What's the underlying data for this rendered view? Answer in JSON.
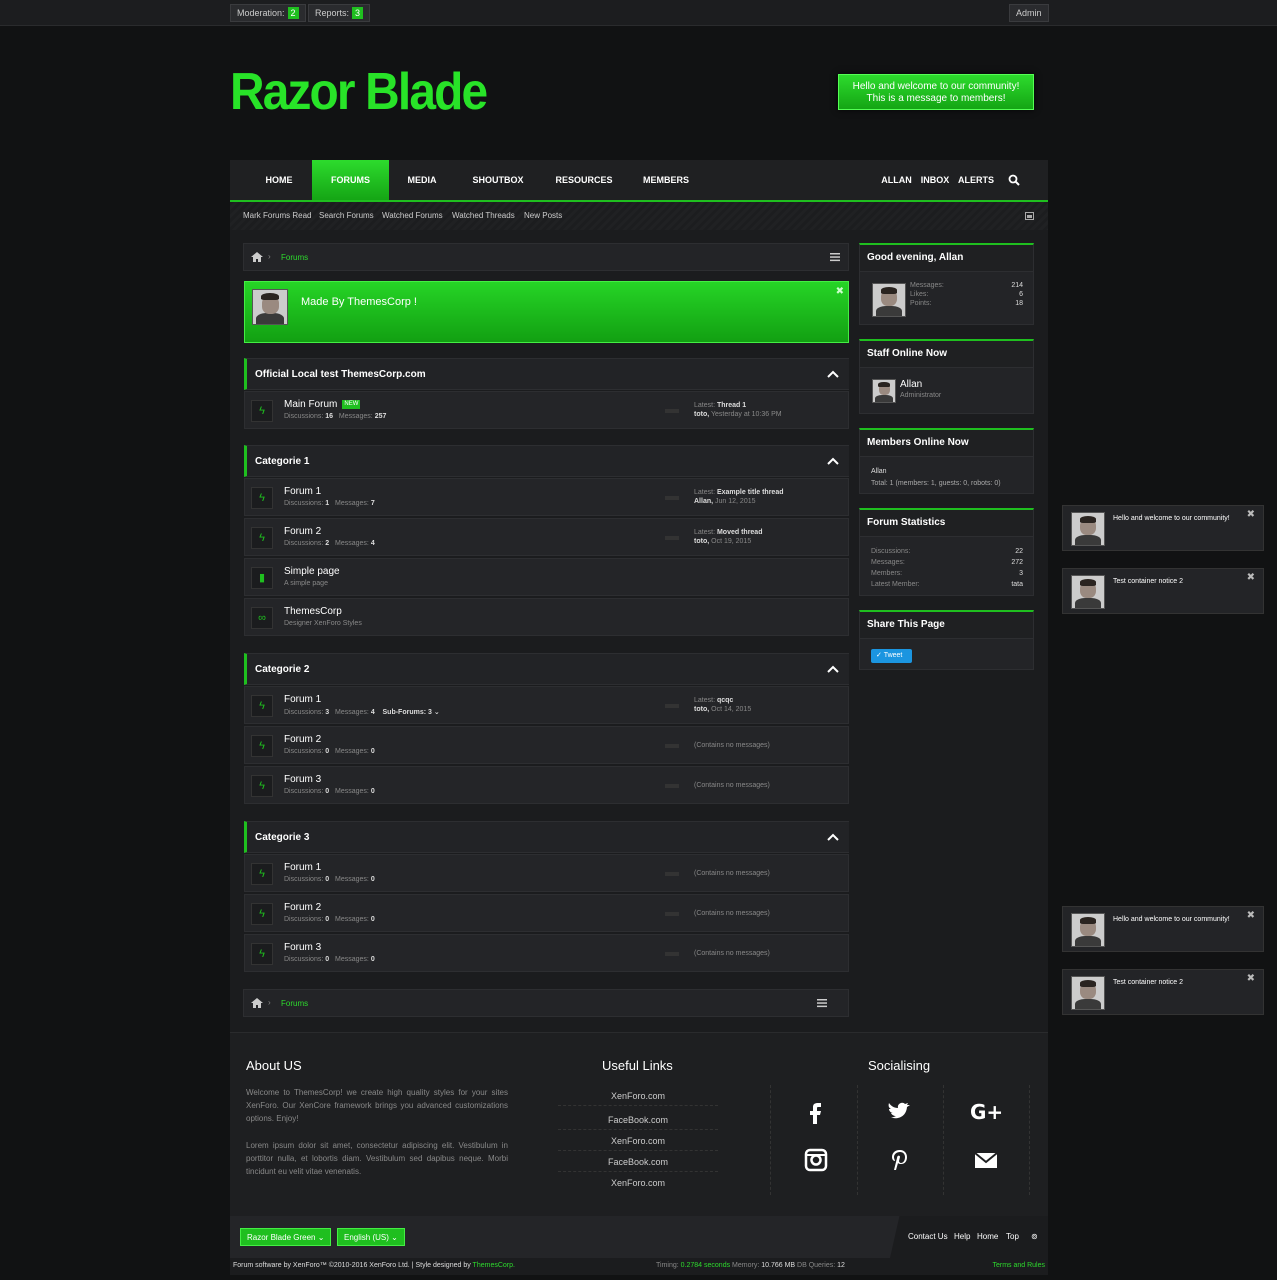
{
  "topbar": {
    "moderation_label": "Moderation:",
    "moderation_count": "2",
    "reports_label": "Reports:",
    "reports_count": "3",
    "admin_label": "Admin"
  },
  "logo": "Razor Blade",
  "welcome": {
    "line1": "Hello and welcome to our community!",
    "line2": "This is a message to members!"
  },
  "nav": {
    "items": [
      "HOME",
      "FORUMS",
      "MEDIA",
      "SHOUTBOX",
      "RESOURCES",
      "MEMBERS"
    ],
    "right": [
      "ALLAN",
      "INBOX",
      "ALERTS"
    ]
  },
  "subnav": [
    "Mark Forums Read",
    "Search Forums",
    "Watched Forums",
    "Watched Threads",
    "New Posts"
  ],
  "breadcrumb": "Forums",
  "notice": "Made By ThemesCorp !",
  "categories": [
    {
      "title": "Official Local test ThemesCorp.com"
    },
    {
      "title": "Categorie 1"
    },
    {
      "title": "Categorie 2"
    },
    {
      "title": "Categorie 3"
    }
  ],
  "rows": {
    "main": {
      "name": "Main Forum",
      "new": "NEW",
      "disc": "16",
      "msg": "257",
      "latest_label": "Latest:",
      "latest": "Thread 1",
      "by": "toto,",
      "when": "Yesterday at 10:36 PM"
    },
    "c1f1": {
      "name": "Forum 1",
      "disc": "1",
      "msg": "7",
      "latest": "Example title thread",
      "by": "Allan,",
      "when": "Jun 12, 2015"
    },
    "c1f2": {
      "name": "Forum 2",
      "disc": "2",
      "msg": "4",
      "latest": "Moved thread",
      "by": "toto,",
      "when": "Oct 19, 2015"
    },
    "simple": {
      "name": "Simple page",
      "desc": "A simple page"
    },
    "tc": {
      "name": "ThemesCorp",
      "desc": "Designer XenForo Styles"
    },
    "c2f1": {
      "name": "Forum 1",
      "disc": "3",
      "msg": "4",
      "sub": "Sub-Forums: 3",
      "latest": "qcqc",
      "by": "toto,",
      "when": "Oct 14, 2015"
    },
    "c2f2": {
      "name": "Forum 2",
      "disc": "0",
      "msg": "0"
    },
    "c2f3": {
      "name": "Forum 3",
      "disc": "0",
      "msg": "0"
    },
    "c3f1": {
      "name": "Forum 1",
      "disc": "0",
      "msg": "0"
    },
    "c3f2": {
      "name": "Forum 2",
      "disc": "0",
      "msg": "0"
    },
    "c3f3": {
      "name": "Forum 3",
      "disc": "0",
      "msg": "0"
    }
  },
  "labels": {
    "discussions": "Discussions:",
    "messages": "Messages:",
    "empty": "(Contains no messages)"
  },
  "sidebar": {
    "greeting": "Good evening, Allan",
    "user_stats": [
      {
        "k": "Messages:",
        "v": "214"
      },
      {
        "k": "Likes:",
        "v": "6"
      },
      {
        "k": "Points:",
        "v": "18"
      }
    ],
    "staff_title": "Staff Online Now",
    "staff_name": "Allan",
    "staff_role": "Administrator",
    "members_title": "Members Online Now",
    "members_name": "Allan",
    "members_total": "Total: 1 (members: 1, guests: 0, robots: 0)",
    "stats_title": "Forum Statistics",
    "stats": [
      {
        "k": "Discussions:",
        "v": "22"
      },
      {
        "k": "Messages:",
        "v": "272"
      },
      {
        "k": "Members:",
        "v": "3"
      },
      {
        "k": "Latest Member:",
        "v": "tata"
      }
    ],
    "share_title": "Share This Page",
    "tweet": "Tweet"
  },
  "footer": {
    "about_title": "About US",
    "about_p1": "Welcome to ThemesCorp! we create high quality styles for your sites XenForo. Our XenCore framework brings you advanced customizations options. Enjoy!",
    "about_p2": "Lorem ipsum dolor sit amet, consectetur adipiscing elit. Vestibulum in porttitor nulla, et lobortis diam. Vestibulum sed dapibus neque. Morbi tincidunt eu velit vitae venenatis.",
    "links_title": "Useful Links",
    "links": [
      "XenForo.com",
      "FaceBook.com",
      "XenForo.com",
      "FaceBook.com",
      "XenForo.com"
    ],
    "social_title": "Socialising"
  },
  "bottombar": {
    "style": "Razor Blade Green",
    "lang": "English (US)",
    "links": [
      "Contact Us",
      "Help",
      "Home",
      "Top"
    ]
  },
  "credit": {
    "left": "Forum software by XenForo™ ©2010-2016 XenForo Ltd. | Style designed by",
    "brand": "ThemesCorp.",
    "timing_label": "Timing:",
    "timing": "0.2784 seconds",
    "memory_label": "Memory:",
    "memory": "10.766 MB",
    "db_label": "DB Queries:",
    "db": "12",
    "terms": "Terms and Rules"
  },
  "toasts": [
    "Hello and welcome to our community!",
    "Test container notice 2",
    "Hello and welcome to our community!",
    "Test container notice 2"
  ]
}
